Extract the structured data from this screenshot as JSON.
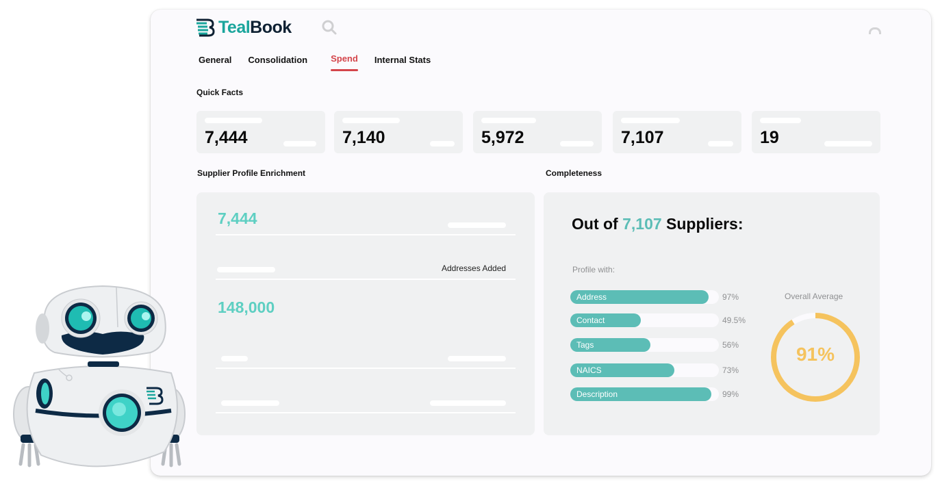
{
  "app": {
    "brand_prefix": "Teal",
    "brand_suffix": "Book",
    "brand_color": "#1aa59c",
    "accent_color": "#d4454b"
  },
  "header": {
    "search_icon": "search-icon",
    "user_icon": "user-icon"
  },
  "tabs": [
    {
      "label": "General",
      "active": false
    },
    {
      "label": "Consolidation",
      "active": false
    },
    {
      "label": "Spend",
      "active": true
    },
    {
      "label": "Internal Stats",
      "active": false
    }
  ],
  "quick_facts": {
    "title": "Quick Facts",
    "cards": [
      {
        "value": "7,444"
      },
      {
        "value": "7,140"
      },
      {
        "value": "5,972"
      },
      {
        "value": "7,107"
      },
      {
        "value": "19"
      }
    ]
  },
  "enrichment": {
    "title": "Supplier Profile Enrichment",
    "primary_value": "7,444",
    "addresses_label": "Addresses Added",
    "addresses_value": "148,000"
  },
  "completeness": {
    "title": "Completeness",
    "heading_prefix": "Out of",
    "heading_number": "7,107",
    "heading_suffix": "Suppliers:",
    "profile_with_label": "Profile with:",
    "bars": [
      {
        "label": "Address",
        "percent": 97,
        "display": "97%"
      },
      {
        "label": "Contact",
        "percent": 49.5,
        "display": "49.5%"
      },
      {
        "label": "Tags",
        "percent": 56,
        "display": "56%"
      },
      {
        "label": "NAICS",
        "percent": 73,
        "display": "73%"
      },
      {
        "label": "Description",
        "percent": 99,
        "display": "99%"
      }
    ],
    "overall_label": "Overall Average",
    "overall_percent": 91,
    "overall_display": "91%",
    "bar_color": "#5cbdb6",
    "donut_color": "#f5c35e"
  },
  "mascot": {
    "icon": "robot-mascot-icon"
  }
}
